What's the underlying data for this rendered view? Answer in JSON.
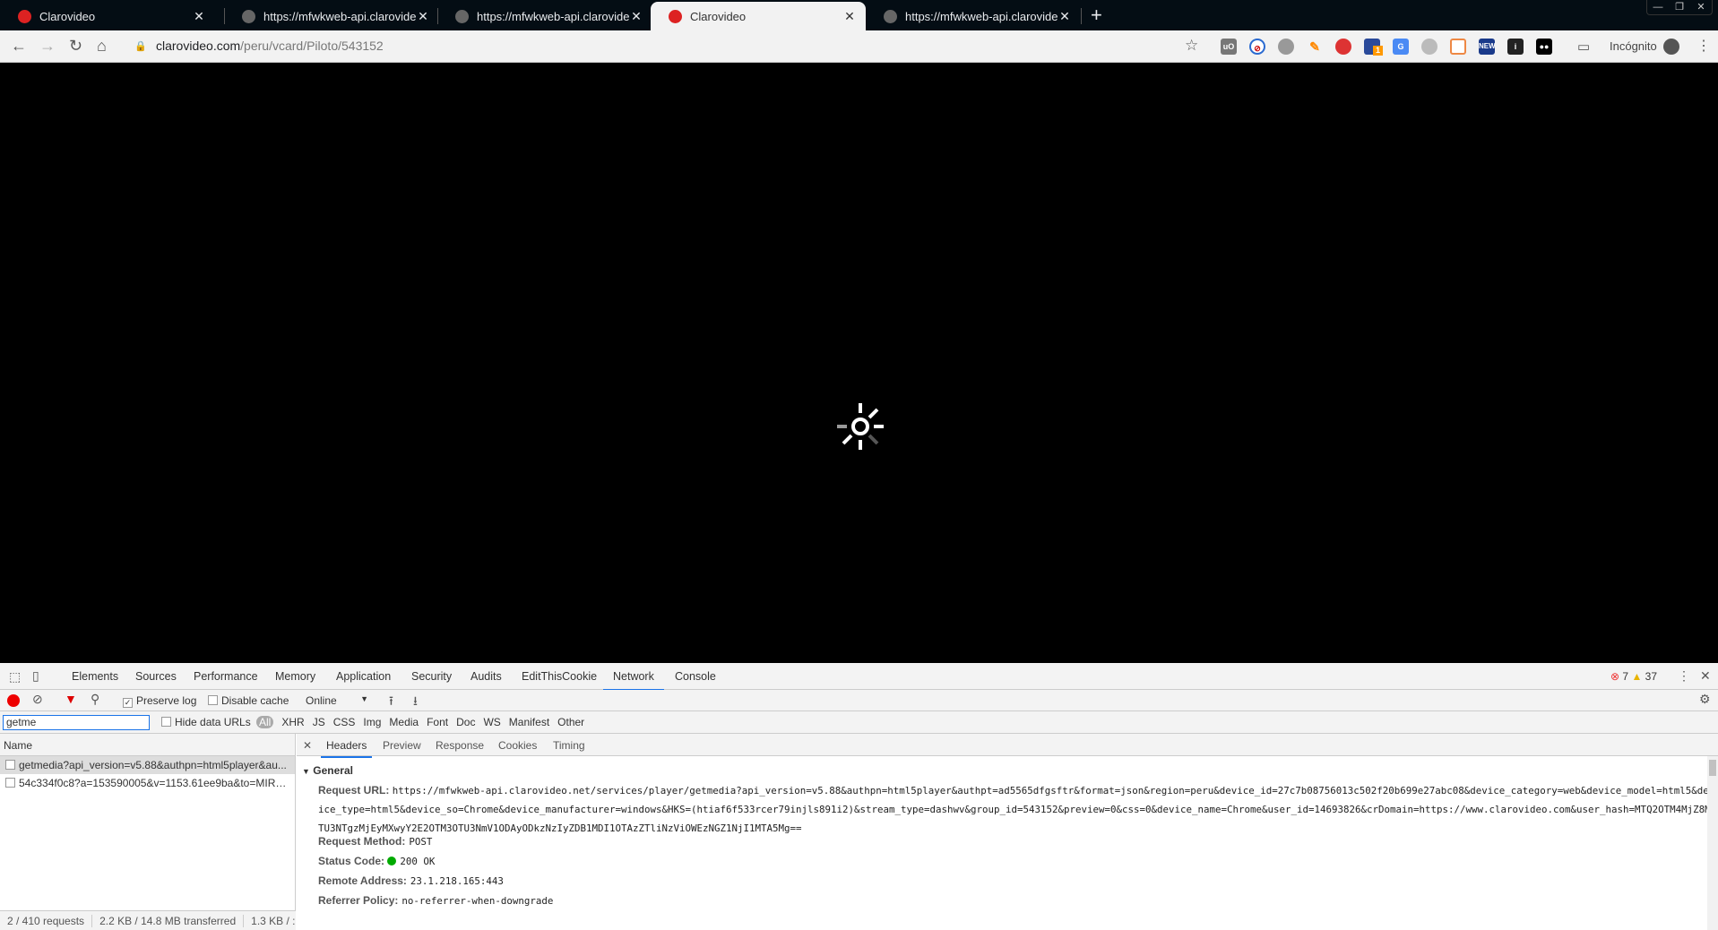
{
  "browser": {
    "tabs": [
      {
        "title": "Clarovideo",
        "favicon": "clarovideo-icon",
        "active": false
      },
      {
        "title": "https://mfwkweb-api.clarovideo.n",
        "favicon": "globe-icon",
        "active": false
      },
      {
        "title": "https://mfwkweb-api.clarovideo.n",
        "favicon": "globe-icon",
        "active": false
      },
      {
        "title": "Clarovideo",
        "favicon": "clarovideo-icon",
        "active": true
      },
      {
        "title": "https://mfwkweb-api.clarovideo.n",
        "favicon": "globe-icon",
        "active": false
      }
    ],
    "url_host": "clarovideo.com",
    "url_path": "/peru/vcard/Piloto/543152",
    "profile_label": "Incógnito",
    "extension_badge": "1",
    "extension_new": "NEW"
  },
  "devtools": {
    "tabs": [
      "Elements",
      "Sources",
      "Performance",
      "Memory",
      "Application",
      "Security",
      "Audits",
      "EditThisCookie",
      "Network",
      "Console"
    ],
    "selected_tab": "Network",
    "errors": "7",
    "warnings": "37",
    "toolbar": {
      "preserve_log": "Preserve log",
      "preserve_log_checked": true,
      "disable_cache": "Disable cache",
      "throttle": "Online"
    },
    "filter": {
      "value": "getme",
      "hide_data_urls": "Hide data URLs",
      "types": [
        "All",
        "XHR",
        "JS",
        "CSS",
        "Img",
        "Media",
        "Font",
        "Doc",
        "WS",
        "Manifest",
        "Other"
      ]
    },
    "name_header": "Name",
    "requests": [
      "getmedia?api_version=v5.88&authpn=html5player&au...",
      "54c334f0c8?a=153590005&v=1153.61ee9ba&to=MIRS..."
    ],
    "status": {
      "requests": "2 / 410 requests",
      "transferred": "2.2 KB / 14.8 MB transferred",
      "resources": "1.3 KB / :"
    },
    "detail_tabs": [
      "Headers",
      "Preview",
      "Response",
      "Cookies",
      "Timing"
    ],
    "general_label": "General",
    "general": {
      "request_url_label": "Request URL:",
      "request_url": "https://mfwkweb-api.clarovideo.net/services/player/getmedia?api_version=v5.88&authpn=html5player&authpt=ad5565dfgsftr&format=json&region=peru&device_id=27c7b08756013c502f20b699e27abc08&device_category=web&device_model=html5&device_type=html5&device_so=Chrome&device_manufacturer=windows&HKS=(htiaf6f533rcer79injls891i2)&stream_type=dashwv&group_id=543152&preview=0&css=0&device_name=Chrome&user_id=14693826&crDomain=https://www.clarovideo.com&user_hash=MTQ2OTM4MjZ8MTU3NTgzMjEyMXwyY2E2OTM3OTU3NmV1ODAyODkzNzIyZDB1MDI1OTAzZTliNzViOWEzNGZ1NjI1MTA5Mg==",
      "method_label": "Request Method:",
      "method": "POST",
      "status_label": "Status Code:",
      "status_code": "200 OK",
      "status_color": "#00aa00",
      "remote_label": "Remote Address:",
      "remote": "23.1.218.165:443",
      "referrer_label": "Referrer Policy:",
      "referrer": "no-referrer-when-downgrade"
    }
  }
}
